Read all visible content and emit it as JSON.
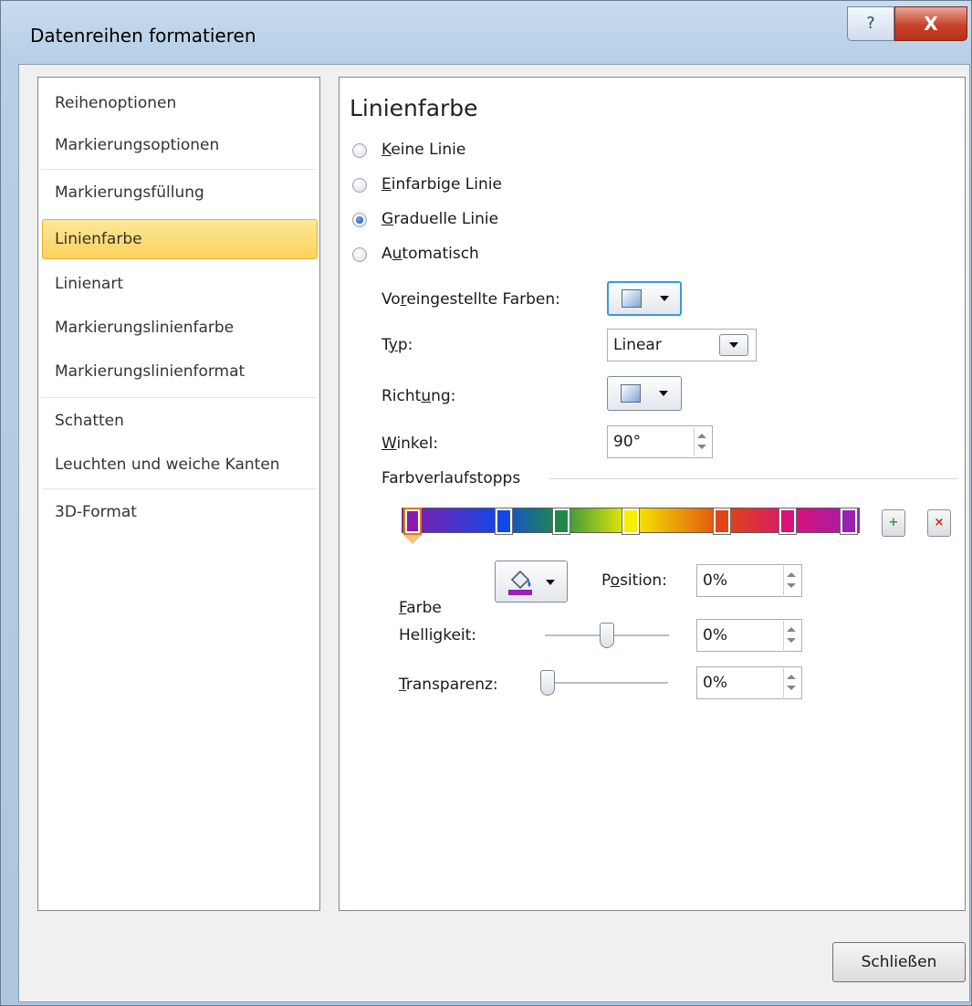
{
  "window": {
    "title": "Datenreihen formatieren",
    "help_glyph": "?",
    "close_glyph": "X"
  },
  "sidebar": {
    "items": [
      {
        "label": "Reihenoptionen",
        "selected": false
      },
      {
        "label": "Markierungsoptionen",
        "selected": false
      },
      {
        "label": "Markierungsfüllung",
        "selected": false
      },
      {
        "label": "Linienfarbe",
        "selected": true
      },
      {
        "label": "Linienart",
        "selected": false
      },
      {
        "label": "Markierungslinienfarbe",
        "selected": false
      },
      {
        "label": "Markierungslinienformat",
        "selected": false
      },
      {
        "label": "Schatten",
        "selected": false
      },
      {
        "label": "Leuchten und weiche Kanten",
        "selected": false
      },
      {
        "label": "3D-Format",
        "selected": false
      }
    ]
  },
  "panel": {
    "title": "Linienfarbe",
    "options": [
      {
        "pre": "",
        "key": "K",
        "post": "eine Linie",
        "selected": false
      },
      {
        "pre": "",
        "key": "E",
        "post": "infarbige Linie",
        "selected": false
      },
      {
        "pre": "",
        "key": "G",
        "post": "raduelle Linie",
        "selected": true
      },
      {
        "pre": "A",
        "key": "u",
        "post": "tomatisch",
        "selected": false
      }
    ],
    "preset_colors": {
      "pre": "Vo",
      "key": "r",
      "post": "eingestellte Farben:"
    },
    "type": {
      "pre": "T",
      "key": "y",
      "post": "p:",
      "value": "Linear"
    },
    "direction": {
      "pre": "Richt",
      "key": "u",
      "post": "ng:"
    },
    "angle": {
      "pre": "",
      "key": "W",
      "post": "inkel:",
      "value": "90°"
    },
    "gradient_stops_label": "Farbverlaufstopps",
    "gradient_stops": [
      {
        "position": 0,
        "color": "#8b1aa8",
        "selected": true
      },
      {
        "position": 0.21,
        "color": "#1446e6"
      },
      {
        "position": 0.34,
        "color": "#1f8a48"
      },
      {
        "position": 0.5,
        "color": "#f5f000"
      },
      {
        "position": 0.71,
        "color": "#e04414"
      },
      {
        "position": 0.86,
        "color": "#d8127a"
      },
      {
        "position": 1.0,
        "color": "#9a20b0"
      }
    ],
    "color": {
      "pre": "",
      "key": "F",
      "post": "arbe"
    },
    "position": {
      "pre": "P",
      "key": "o",
      "post": "sition:",
      "value": "0%"
    },
    "brightness": {
      "pre": "Helli",
      "key": "g",
      "post": "keit:",
      "value": "0%",
      "level": 0.5
    },
    "transparency": {
      "pre": "",
      "key": "T",
      "post": "ransparenz:",
      "value": "0%",
      "level": 0.0
    }
  },
  "footer": {
    "close_label": "Schließen"
  },
  "colors": {
    "selection": "#fbd15b",
    "title_bar": "#b8cfe6",
    "close_red": "#c8412c"
  }
}
